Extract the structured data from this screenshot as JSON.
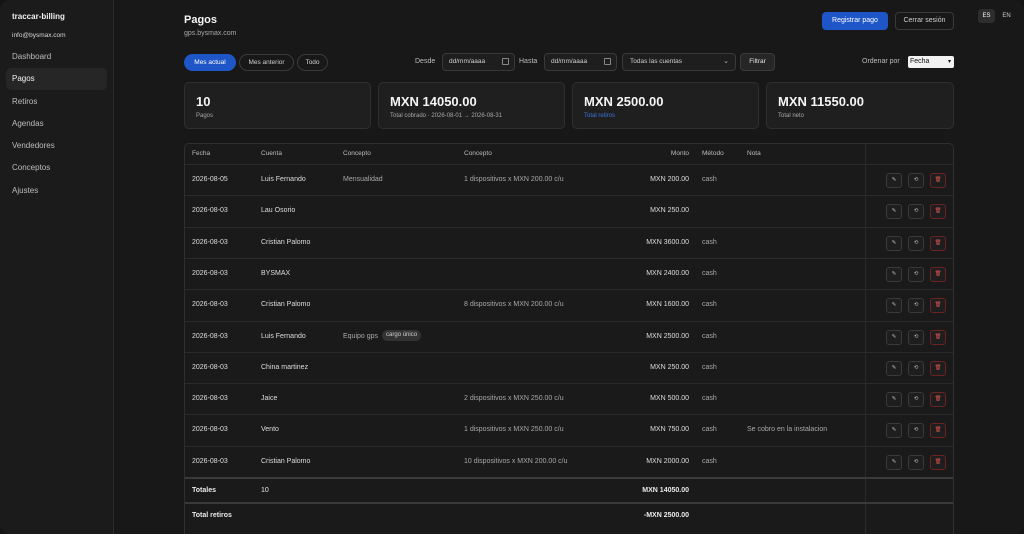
{
  "sidebar": {
    "brand": "traccar-billing",
    "email": "info@bysmax.com",
    "items": [
      {
        "label": "Dashboard"
      },
      {
        "label": "Pagos"
      },
      {
        "label": "Retiros"
      },
      {
        "label": "Agendas"
      },
      {
        "label": "Vendedores"
      },
      {
        "label": "Conceptos"
      },
      {
        "label": "Ajustes"
      }
    ]
  },
  "header": {
    "title": "Pagos",
    "subtitle": "gps.bysmax.com",
    "register_label": "Registrar pago",
    "logout_label": "Cerrar sesión",
    "lang_es": "ES",
    "lang_en": "EN"
  },
  "filters": {
    "tabs": [
      "Mes actual",
      "Mes anterior",
      "Todo"
    ],
    "from_label": "Desde",
    "to_label": "Hasta",
    "from_placeholder": "dd/mm/aaaa",
    "to_placeholder": "dd/mm/aaaa",
    "account_value": "Todas las cuentas",
    "filter_label": "Filtrar",
    "sort_label": "Ordenar por",
    "sort_value": "Fecha"
  },
  "stats": [
    {
      "value": "10",
      "label": "Pagos"
    },
    {
      "value": "MXN 14050.00",
      "label": "Total cobrado · 2026-08-01 → 2026-08-31"
    },
    {
      "value": "MXN 2500.00",
      "label": "Total retiros"
    },
    {
      "value": "MXN 11550.00",
      "label": "Total neto"
    }
  ],
  "colors": {
    "accent": "#1f56c7",
    "danger": "#e05252",
    "link": "#3d74e0"
  },
  "table": {
    "headers": [
      "Fecha",
      "Cuenta",
      "Concepto",
      "Concepto",
      "Monto",
      "Método",
      "Nota"
    ],
    "rows": [
      {
        "date": "2026-08-05",
        "account": "Luis Fernando",
        "concept": "Mensualidad",
        "badge": "",
        "detail": "1 dispositivos x MXN 200.00 c/u",
        "amount": "MXN 200.00",
        "method": "cash",
        "note": ""
      },
      {
        "date": "2026-08-03",
        "account": "Lau Osorio",
        "concept": "",
        "badge": "",
        "detail": "",
        "amount": "MXN 250.00",
        "method": "",
        "note": ""
      },
      {
        "date": "2026-08-03",
        "account": "Cristian Palomo",
        "concept": "",
        "badge": "",
        "detail": "",
        "amount": "MXN 3600.00",
        "method": "cash",
        "note": ""
      },
      {
        "date": "2026-08-03",
        "account": "BYSMAX",
        "concept": "",
        "badge": "",
        "detail": "",
        "amount": "MXN 2400.00",
        "method": "cash",
        "note": ""
      },
      {
        "date": "2026-08-03",
        "account": "Cristian Palomo",
        "concept": "",
        "badge": "",
        "detail": "8 dispositivos x MXN 200.00 c/u",
        "amount": "MXN 1600.00",
        "method": "cash",
        "note": ""
      },
      {
        "date": "2026-08-03",
        "account": "Luis Fernando",
        "concept": "Equipo gps",
        "badge": "cargo único",
        "detail": "",
        "amount": "MXN 2500.00",
        "method": "cash",
        "note": ""
      },
      {
        "date": "2026-08-03",
        "account": "China martinez",
        "concept": "",
        "badge": "",
        "detail": "",
        "amount": "MXN 250.00",
        "method": "cash",
        "note": ""
      },
      {
        "date": "2026-08-03",
        "account": "Jaice",
        "concept": "",
        "badge": "",
        "detail": "2 dispositivos x MXN 250.00 c/u",
        "amount": "MXN 500.00",
        "method": "cash",
        "note": ""
      },
      {
        "date": "2026-08-03",
        "account": "Vento",
        "concept": "",
        "badge": "",
        "detail": "1 dispositivos x MXN 250.00 c/u",
        "amount": "MXN 750.00",
        "method": "cash",
        "note": "Se cobro en la instalacion"
      },
      {
        "date": "2026-08-03",
        "account": "Cristian Palomo",
        "concept": "",
        "badge": "",
        "detail": "10 dispositivos x MXN 200.00 c/u",
        "amount": "MXN 2000.00",
        "method": "cash",
        "note": ""
      }
    ],
    "totals": {
      "label": "Totales",
      "count": "10",
      "amount": "MXN 14050.00"
    },
    "withdrawals": {
      "label": "Total retiros",
      "amount": "-MXN 2500.00"
    },
    "action_icons": [
      "edit-icon",
      "history-icon",
      "trash-icon"
    ]
  }
}
